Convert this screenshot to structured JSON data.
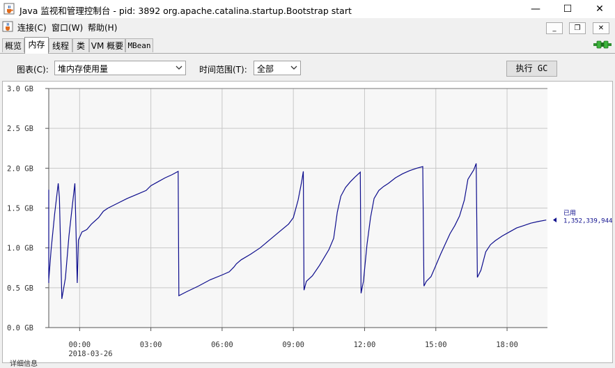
{
  "window": {
    "title": "Java 监视和管理控制台 - pid: 3892 org.apache.catalina.startup.Bootstrap start",
    "minimize_glyph": "—",
    "maximize_glyph": "☐",
    "close_glyph": "✕"
  },
  "menu": {
    "items": [
      {
        "label": "连接(C)"
      },
      {
        "label": "窗口(W)"
      },
      {
        "label": "帮助(H)"
      }
    ],
    "mdi_minimize": "_",
    "mdi_restore": "❐",
    "mdi_close": "✕"
  },
  "tabs": [
    {
      "label": "概览",
      "active": false
    },
    {
      "label": "内存",
      "active": true
    },
    {
      "label": "线程",
      "active": false
    },
    {
      "label": "类",
      "active": false
    },
    {
      "label": "VM 概要",
      "active": false
    },
    {
      "label": "MBean",
      "active": false
    }
  ],
  "controls": {
    "chart_label": "图表(C):",
    "chart_value": "堆内存使用量",
    "range_label": "时间范围(T):",
    "range_value": "全部",
    "gc_button": "执行 GC"
  },
  "status_label": "详细信息",
  "colors": {
    "series": "#0c0c8c",
    "grid": "#c8c8c8",
    "plot_bg": "#f7f7f7",
    "axis_text": "#333333"
  },
  "icons": {
    "app": "java-cup-icon",
    "connection": "plug-connected-icon",
    "combo_arrow": "chevron-down-icon",
    "legend_marker": "triangle-left-icon"
  },
  "chart_data": {
    "type": "line",
    "title": "",
    "xlabel": "",
    "ylabel": "",
    "y_unit": "GB",
    "ylim": [
      0,
      3
    ],
    "yticks": [
      {
        "value": 0.0,
        "label": "0.0 GB"
      },
      {
        "value": 0.5,
        "label": "0.5 GB"
      },
      {
        "value": 1.0,
        "label": "1.0 GB"
      },
      {
        "value": 1.5,
        "label": "1.5 GB"
      },
      {
        "value": 2.0,
        "label": "2.0 GB"
      },
      {
        "value": 2.5,
        "label": "2.5 GB"
      },
      {
        "value": 3.0,
        "label": "3.0 GB"
      }
    ],
    "xlim": [
      -1.3,
      19.7
    ],
    "xticks": [
      {
        "value": 0,
        "label": "00:00"
      },
      {
        "value": 3,
        "label": "03:00"
      },
      {
        "value": 6,
        "label": "06:00"
      },
      {
        "value": 9,
        "label": "09:00"
      },
      {
        "value": 12,
        "label": "12:00"
      },
      {
        "value": 15,
        "label": "15:00"
      },
      {
        "value": 18,
        "label": "18:00"
      }
    ],
    "date_label": {
      "value": 0,
      "label": "2018-03-26"
    },
    "grid": true,
    "legend": {
      "position": "right",
      "name": "已用",
      "value_label": "1,352,339,944"
    },
    "series": [
      {
        "name": "已用",
        "x": [
          -1.85,
          -1.75,
          -1.6,
          -1.45,
          -1.4,
          -1.35,
          -1.2,
          -1.05,
          -0.9,
          -0.85,
          -0.75,
          -0.6,
          -0.45,
          -0.3,
          -0.2,
          -0.1,
          -0.05,
          0.1,
          0.3,
          0.5,
          0.8,
          1.0,
          1.2,
          1.6,
          2.0,
          2.4,
          2.8,
          3.0,
          3.3,
          3.6,
          3.9,
          4.15,
          4.18,
          4.5,
          5.0,
          5.5,
          6.0,
          6.3,
          6.5,
          6.6,
          6.8,
          7.2,
          7.6,
          8.0,
          8.4,
          8.8,
          9.0,
          9.2,
          9.35,
          9.42,
          9.45,
          9.55,
          9.8,
          10.1,
          10.3,
          10.5,
          10.7,
          10.85,
          11.0,
          11.2,
          11.4,
          11.6,
          11.82,
          11.85,
          11.95,
          12.1,
          12.25,
          12.4,
          12.6,
          12.8,
          13.0,
          13.3,
          13.6,
          13.9,
          14.2,
          14.45,
          14.5,
          14.6,
          14.8,
          15.0,
          15.2,
          15.4,
          15.6,
          15.8,
          16.0,
          16.2,
          16.35,
          16.6,
          16.7,
          16.75,
          16.9,
          17.1,
          17.3,
          17.5,
          17.8,
          18.1,
          18.4,
          18.7,
          19.0,
          19.3,
          19.65
        ],
        "values": [
          1.18,
          1.25,
          1.6,
          1.73,
          0.56,
          0.6,
          0.98,
          1.43,
          1.81,
          1.63,
          0.36,
          0.62,
          1.15,
          1.55,
          1.81,
          0.56,
          1.1,
          1.2,
          1.23,
          1.3,
          1.38,
          1.46,
          1.5,
          1.56,
          1.62,
          1.67,
          1.72,
          1.78,
          1.83,
          1.88,
          1.92,
          1.96,
          0.4,
          0.45,
          0.52,
          0.6,
          0.66,
          0.7,
          0.76,
          0.8,
          0.85,
          0.92,
          1.0,
          1.1,
          1.2,
          1.3,
          1.38,
          1.6,
          1.83,
          1.96,
          0.47,
          0.58,
          0.65,
          0.78,
          0.88,
          0.98,
          1.12,
          1.45,
          1.65,
          1.76,
          1.83,
          1.89,
          1.95,
          0.43,
          0.58,
          1.04,
          1.38,
          1.62,
          1.72,
          1.77,
          1.81,
          1.88,
          1.93,
          1.97,
          2.0,
          2.02,
          0.52,
          0.58,
          0.64,
          0.78,
          0.92,
          1.05,
          1.18,
          1.28,
          1.4,
          1.6,
          1.86,
          1.98,
          2.06,
          0.63,
          0.72,
          0.95,
          1.04,
          1.09,
          1.15,
          1.2,
          1.25,
          1.28,
          1.31,
          1.33,
          1.35
        ]
      }
    ]
  }
}
